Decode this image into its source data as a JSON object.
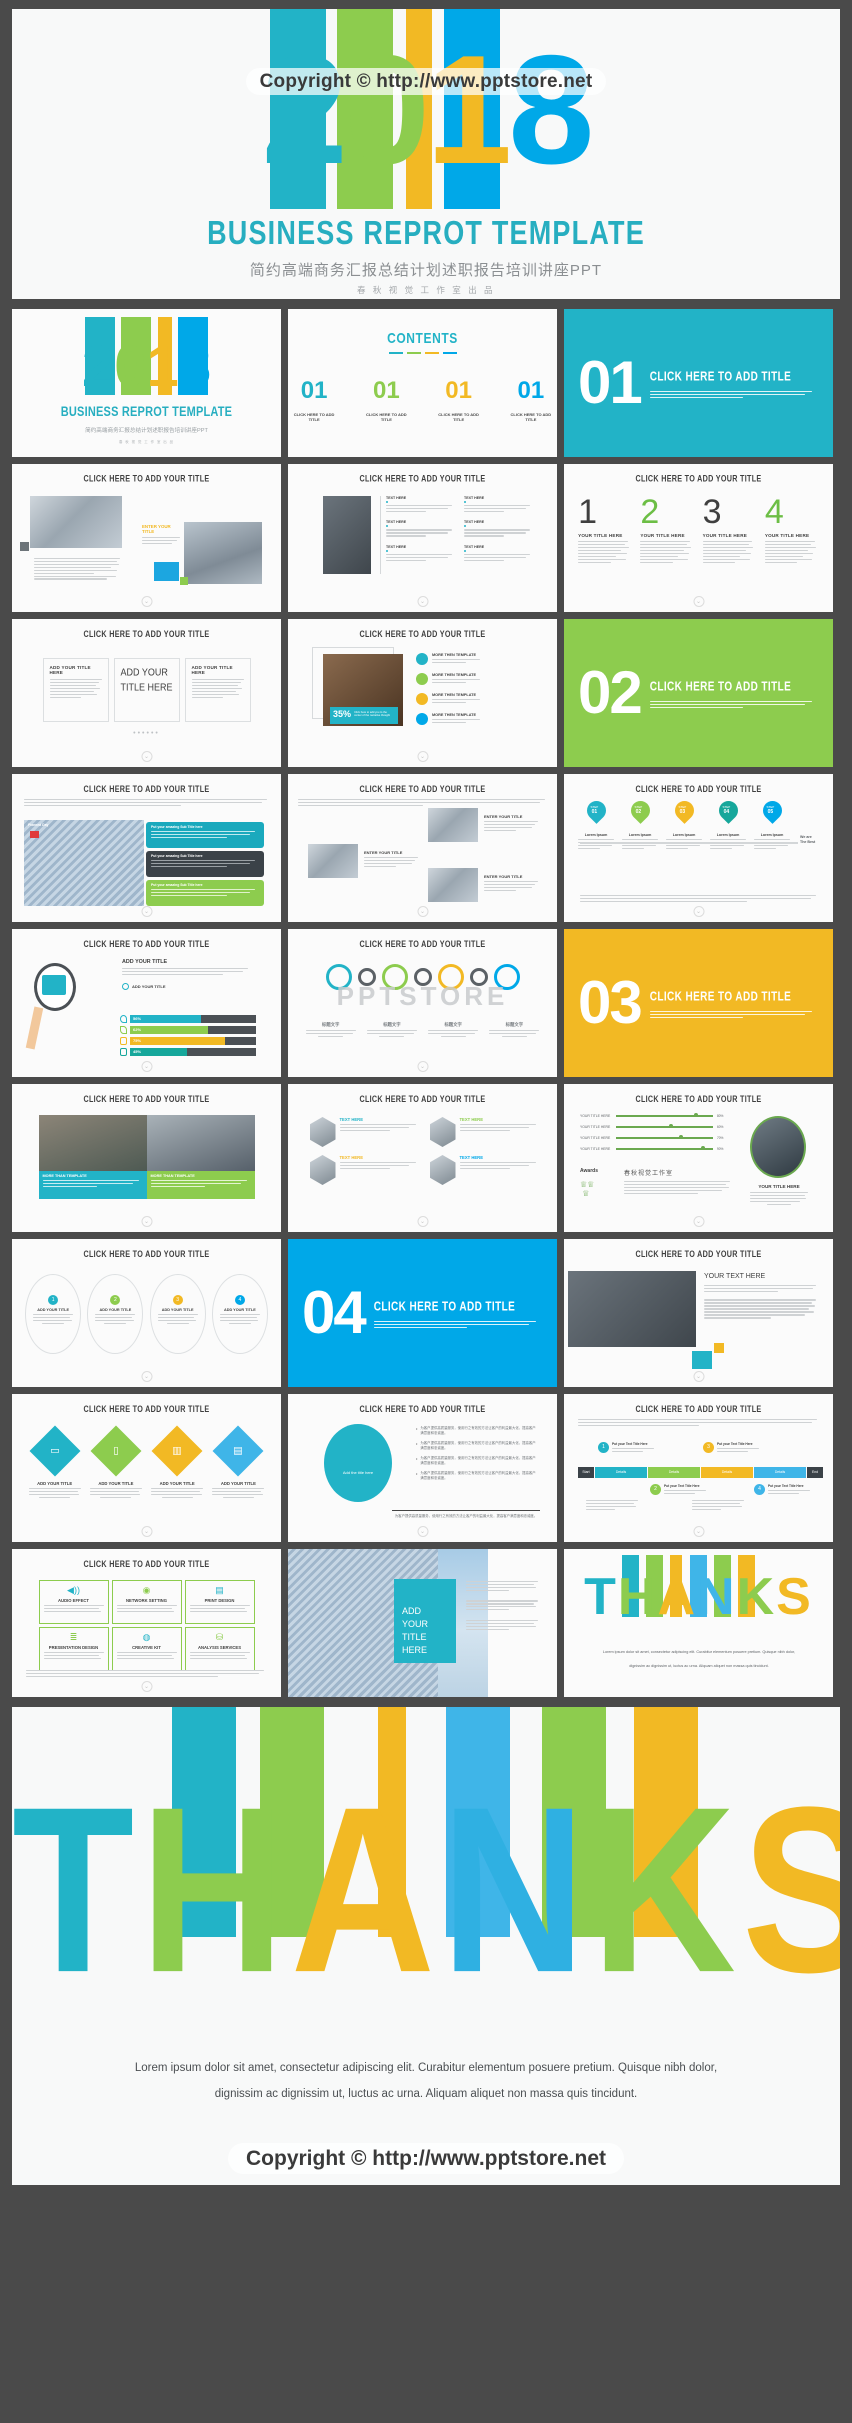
{
  "brand": {
    "teal": "#22b3c7",
    "green": "#8dcc4e",
    "yellow": "#f2b924",
    "blue": "#00a8e8",
    "dark": "#3c4043",
    "page_bg": "#4a4a4a",
    "slide_bg": "#fbfbfb"
  },
  "hero": {
    "watermark": "Copyright © http://www.pptstore.net",
    "year_digits": [
      "2",
      "0",
      "1",
      "8"
    ],
    "title": "BUSINESS REPROT TEMPLATE",
    "subtitle": "简约高端商务汇报总结计划述职报告培训讲座PPT",
    "studio": "春 秋 视 觉 工 作 室 出 品"
  },
  "common": {
    "slide_title": "CLICK HERE TO ADD YOUR TITLE",
    "add_title": "CLICK HERE TO ADD TITLE",
    "your_title": "YOUR TITLE HERE",
    "add_your_title": "ADD YOUR TITLE",
    "add_your_title_here": "ADD YOUR TITLE HERE",
    "enter_your_title": "ENTER YOUR TITLE",
    "your_text_here": "YOUR TEXT HERE",
    "text_here": "TEXT HERE",
    "more_than_template": "MORE THAN TEMPLATE",
    "more_then_template": "MORE THEN TEMPLATE",
    "lorem_short": "Lorem ipsum dolor sit amet, consectetur adipiscing elit. Curabitur elementum posuere pretium. Quisque nibh dolor, dignissim ac dignissim ut, luctus ac urna. Aliquam aliquet non massa quis tincidunt.",
    "add_title_here": "ADD YOUR TITLE HERE"
  },
  "slides": [
    {
      "n": 1,
      "name": "cover",
      "title": "BUSINESS REPROT TEMPLATE"
    },
    {
      "n": 2,
      "name": "contents",
      "title": "CONTENTS",
      "items": [
        {
          "num": "01",
          "label": "CLICK HERE TO ADD TITLE",
          "color": "#22b3c7"
        },
        {
          "num": "01",
          "label": "CLICK HERE TO ADD TITLE",
          "color": "#8dcc4e"
        },
        {
          "num": "01",
          "label": "CLICK HERE TO ADD TITLE",
          "color": "#f2b924"
        },
        {
          "num": "01",
          "label": "CLICK HERE TO ADD TITLE",
          "color": "#00a8e8"
        }
      ]
    },
    {
      "n": 3,
      "name": "section-01",
      "num": "01",
      "bg": "#22b3c7",
      "title": "CLICK HERE TO ADD TITLE"
    },
    {
      "n": 4,
      "name": "image-text",
      "title": "CLICK HERE TO ADD YOUR TITLE"
    },
    {
      "n": 5,
      "name": "two-col-list",
      "title": "CLICK HERE TO ADD YOUR TITLE"
    },
    {
      "n": 6,
      "name": "numbers-1234",
      "title": "CLICK HERE TO ADD YOUR TITLE",
      "numbers": [
        "1",
        "2",
        "3",
        "4"
      ],
      "labels": [
        "YOUR TITLE HERE",
        "YOUR TITLE HERE",
        "YOUR TITLE HERE",
        "YOUR TITLE HERE"
      ]
    },
    {
      "n": 7,
      "name": "three-cards",
      "title": "CLICK HERE TO ADD YOUR TITLE",
      "cards": [
        "ADD YOUR TITLE HERE",
        "ADD YOUR TITLE HERE",
        "ADD YOUR TITLE HERE"
      ],
      "center": "ADD YOUR TITLE HERE"
    },
    {
      "n": 8,
      "name": "photo-stat",
      "title": "CLICK HERE TO ADD YOUR TITLE",
      "stat": "35%",
      "stat_note": "Click here to add  you to the center of the narrative thought",
      "bullets": [
        "MORE THEN TEMPLATE",
        "MORE THEN TEMPLATE",
        "MORE THEN TEMPLATE",
        "MORE THEN TEMPLATE"
      ]
    },
    {
      "n": 9,
      "name": "section-02",
      "num": "02",
      "bg": "#8dcc4e",
      "title": "CLICK HERE TO ADD TITLE"
    },
    {
      "n": 10,
      "name": "photo-3bars",
      "title": "CLICK HERE TO ADD YOUR TITLE",
      "photo_label": "Planned Day"
    },
    {
      "n": 11,
      "name": "device-grid",
      "title": "CLICK HERE TO ADD YOUR TITLE",
      "entries": [
        "ENTER YOUR TITLE",
        "ENTER YOUR TITLE",
        "ENTER YOUR TITLE"
      ]
    },
    {
      "n": 12,
      "name": "timeline-steps",
      "title": "CLICK HERE TO ADD YOUR TITLE",
      "steps": [
        {
          "step": "STEP",
          "num": "01",
          "color": "#22b3c7",
          "label": "Lorem Ipsum"
        },
        {
          "step": "STEP",
          "num": "02",
          "color": "#8dcc4e",
          "label": "Lorem Ipsum"
        },
        {
          "step": "STEP",
          "num": "03",
          "color": "#f2b924",
          "label": "Lorem Ipsum"
        },
        {
          "step": "STEP",
          "num": "04",
          "color": "#16a79b",
          "label": "Lorem Ipsum"
        },
        {
          "step": "STEP",
          "num": "05",
          "color": "#00a8e8",
          "label": "Lorem Ipsum"
        }
      ],
      "end_label": "We are\nThe Best"
    },
    {
      "n": 13,
      "name": "magnifier-bars",
      "title": "CLICK HERE TO ADD YOUR TITLE",
      "heading": "ADD YOUR TITLE",
      "sub": "ADD YOUR TITLE",
      "bars": [
        {
          "value": "56%",
          "color": "#22b3c7"
        },
        {
          "value": "62%",
          "color": "#8dcc4e"
        },
        {
          "value": "75%",
          "color": "#f2b924"
        },
        {
          "value": "45%",
          "color": "#16a79b"
        }
      ]
    },
    {
      "n": 14,
      "name": "gears",
      "title": "CLICK HERE TO ADD YOUR TITLE",
      "watermark": "PPTSTORE"
    },
    {
      "n": 15,
      "name": "section-03",
      "num": "03",
      "bg": "#f2b924",
      "title": "CLICK HERE TO ADD TITLE"
    },
    {
      "n": 16,
      "name": "two-photos",
      "title": "CLICK HERE TO ADD YOUR TITLE",
      "captions": [
        "MORE THAN TEMPLATE",
        "MORE THAN TEMPLATE"
      ]
    },
    {
      "n": 17,
      "name": "hex-four",
      "title": "CLICK HERE TO ADD YOUR TITLE",
      "labels": [
        {
          "text": "TEXT HERE",
          "color": "#22b3c7"
        },
        {
          "text": "TEXT HERE",
          "color": "#8dcc4e"
        },
        {
          "text": "TEXT HERE",
          "color": "#f2b924"
        },
        {
          "text": "TEXT HERE",
          "color": "#00a8e8"
        }
      ]
    },
    {
      "n": 18,
      "name": "sliders-awards",
      "title": "CLICK HERE TO ADD YOUR TITLE",
      "rows": [
        {
          "label": "YOUR TITLE HERE",
          "value": "80%",
          "fill": 80
        },
        {
          "label": "YOUR TITLE HERE",
          "value": "60%",
          "fill": 55
        },
        {
          "label": "YOUR TITLE HERE",
          "value": "70%",
          "fill": 65
        },
        {
          "label": "YOUR TITLE HERE",
          "value": "90%",
          "fill": 88
        }
      ],
      "awards": "Awards",
      "awards_cn": "春秋视觉工作室",
      "right_title": "YOUR TITLE HERE"
    },
    {
      "n": 19,
      "name": "oval-four",
      "title": "CLICK HERE TO ADD YOUR TITLE",
      "items": [
        {
          "num": "1",
          "label": "ADD YOUR TITLE",
          "color": "#22b3c7"
        },
        {
          "num": "2",
          "label": "ADD YOUR TITLE",
          "color": "#8dcc4e"
        },
        {
          "num": "3",
          "label": "ADD YOUR TITLE",
          "color": "#f2b924"
        },
        {
          "num": "4",
          "label": "ADD YOUR TITLE",
          "color": "#00a8e8"
        }
      ]
    },
    {
      "n": 20,
      "name": "section-04",
      "num": "04",
      "bg": "#00a8e8",
      "title": "CLICK HERE TO ADD TITLE"
    },
    {
      "n": 21,
      "name": "laptop-text",
      "title": "CLICK HERE TO ADD YOUR TITLE",
      "heading": "YOUR TEXT HERE"
    },
    {
      "n": 22,
      "name": "diamonds-four",
      "title": "CLICK HERE TO ADD YOUR TITLE",
      "items": [
        {
          "icon": "monitor-icon",
          "label": "ADD YOUR TITLE",
          "color": "#22b3c7"
        },
        {
          "icon": "phone-icon",
          "label": "ADD YOUR TITLE",
          "color": "#8dcc4e"
        },
        {
          "icon": "chart-icon",
          "label": "ADD YOUR TITLE",
          "color": "#f2b924"
        },
        {
          "icon": "calendar-icon",
          "label": "ADD YOUR TITLE",
          "color": "#00a8e8"
        }
      ]
    },
    {
      "n": 23,
      "name": "circle-bullets",
      "title": "CLICK HERE TO ADD YOUR TITLE",
      "circle_label": "Add the title here"
    },
    {
      "n": 24,
      "name": "process-flow",
      "title": "CLICK HERE TO ADD YOUR TITLE",
      "start": "Start",
      "end": "End",
      "stages": [
        "Details",
        "Details",
        "Details",
        "Details"
      ],
      "markers": [
        {
          "num": "1",
          "color": "#22b3c7",
          "label": "Put your Text Title Here"
        },
        {
          "num": "2",
          "color": "#8dcc4e",
          "label": "Put your Text Title Here"
        },
        {
          "num": "3",
          "color": "#f2b924",
          "label": "Put your Text Title Here"
        },
        {
          "num": "4",
          "color": "#00a8e8",
          "label": "Put your Text Title Here"
        }
      ]
    },
    {
      "n": 25,
      "name": "six-services",
      "title": "CLICK HERE TO ADD YOUR TITLE",
      "services": [
        {
          "name": "AUDIO EFFECT",
          "icon": "speaker-icon"
        },
        {
          "name": "NETWORK SETTING",
          "icon": "network-icon"
        },
        {
          "name": "PRINT DESIGN",
          "icon": "printer-icon"
        },
        {
          "name": "PRESENTATION DESIGN",
          "icon": "layers-icon"
        },
        {
          "name": "CREATIVE KIT",
          "icon": "bulb-icon"
        },
        {
          "name": "ANALYSIS SERVICES",
          "icon": "database-icon"
        }
      ]
    },
    {
      "n": 26,
      "name": "building-panel",
      "panel_title": "ADD YOUR\nTITLE HERE"
    },
    {
      "n": 27,
      "name": "thanks-slide",
      "word": "THANKS"
    }
  ],
  "thanks": {
    "letters": [
      {
        "ch": "T",
        "color": "#22b3c7"
      },
      {
        "ch": "H",
        "color": "#8dcc4e"
      },
      {
        "ch": "A",
        "color": "#f2b924"
      },
      {
        "ch": "N",
        "color": "#2fb0e2"
      },
      {
        "ch": "K",
        "color": "#8dcc4e"
      },
      {
        "ch": "S",
        "color": "#f2b924"
      }
    ],
    "desc_line1": "Lorem ipsum dolor sit amet, consectetur adipiscing elit. Curabitur elementum posuere pretium. Quisque nibh dolor,",
    "desc_line2": "dignissim ac dignissim ut, luctus ac urna. Aliquam aliquet non massa quis tincidunt.",
    "watermark": "Copyright © http://www.pptstore.net"
  }
}
